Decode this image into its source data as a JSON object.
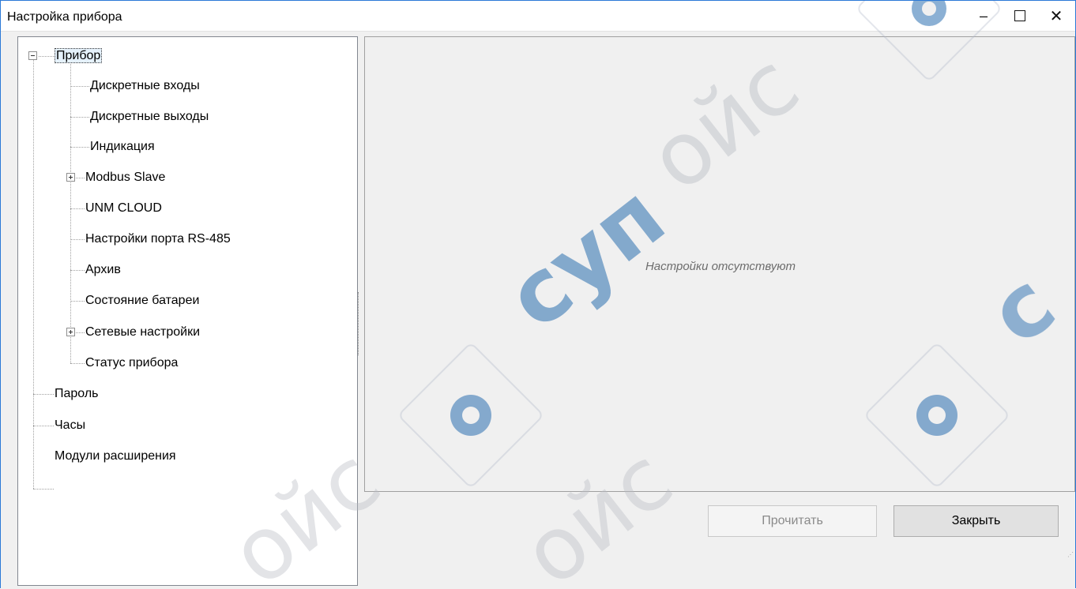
{
  "window": {
    "title": "Настройка прибора",
    "minimize_glyph": "–",
    "maximize_glyph": "☐",
    "close_glyph": "✕"
  },
  "tree": {
    "root": {
      "label": "Прибор",
      "expanded": true,
      "selected": true
    },
    "children": [
      {
        "label": "Дискретные входы",
        "expander": false
      },
      {
        "label": "Дискретные выходы",
        "expander": false
      },
      {
        "label": "Индикация",
        "expander": false
      },
      {
        "label": "Modbus Slave",
        "expander": true
      },
      {
        "label": "UNM CLOUD",
        "expander": false
      },
      {
        "label": "Настройки порта RS-485",
        "expander": false
      },
      {
        "label": "Архив",
        "expander": false
      },
      {
        "label": "Состояние батареи",
        "expander": false
      },
      {
        "label": "Сетевые настройки",
        "expander": true
      },
      {
        "label": "Статус прибора",
        "expander": false
      }
    ],
    "top_level": [
      {
        "label": "Пароль"
      },
      {
        "label": "Часы"
      },
      {
        "label": "Модули расширения"
      }
    ]
  },
  "panel": {
    "empty_message": "Настройки отсутствуют"
  },
  "buttons": {
    "read_label": "Прочитать",
    "read_enabled": false,
    "close_label": "Закрыть"
  },
  "watermark": {
    "text": "супероайс",
    "color": "#2b6fb0"
  }
}
